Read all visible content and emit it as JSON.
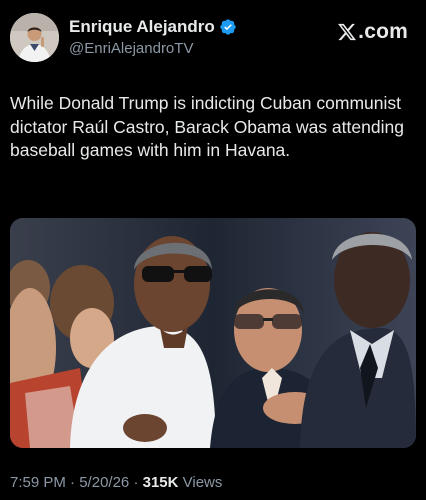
{
  "author": {
    "display_name": "Enrique Alejandro",
    "handle": "@EnriAlejandroTV",
    "verified": true
  },
  "brand": {
    "logo_icon": "x-logo-icon",
    "text": ".com"
  },
  "post": {
    "text": "While Donald Trump is indicting Cuban communist dictator Raúl Castro, Barack Obama was attending baseball games with him in Havana.",
    "time": "7:59 PM",
    "separator": "·",
    "date": "5/20/26",
    "views_count": "315K",
    "views_label": "Views"
  },
  "colors": {
    "background": "#000000",
    "text_primary": "#e7e9ea",
    "text_secondary": "#8b98a5",
    "verified_badge": "#1d9bf0"
  }
}
